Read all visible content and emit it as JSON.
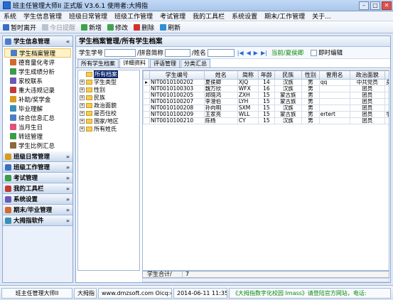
{
  "window": {
    "title": "班主任管理大师II 正式版 V3.6.1  使用者:大拇指",
    "min": "–",
    "max": "□",
    "close": "✕"
  },
  "menu": [
    "系统",
    "学生信息管理",
    "班级日常管理",
    "班级工作管理",
    "考试管理",
    "我的工具栏",
    "系统设置",
    "期末/工作管理",
    "关于..."
  ],
  "toolbar": [
    {
      "label": "暂时离开",
      "color": "#3a6fc4",
      "disabled": false
    },
    {
      "label": "今日提醒",
      "color": "#b9c2cf",
      "disabled": true
    },
    {
      "label": "新增",
      "color": "#3fa34d",
      "disabled": false
    },
    {
      "label": "修改",
      "color": "#3fa34d",
      "disabled": false
    },
    {
      "label": "删除",
      "color": "#d0332d",
      "disabled": false
    },
    {
      "label": "刷新",
      "color": "#2f8fd6",
      "disabled": false
    }
  ],
  "sidebar": {
    "group1": {
      "label": "学生信息管理",
      "chevron": "«",
      "items": [
        {
          "label": "学生档案管理",
          "color": "#4a7ec9",
          "selected": true
        },
        {
          "label": "德育量化考评",
          "color": "#d26a2e"
        },
        {
          "label": "学生成绩分析",
          "color": "#3b9c4a"
        },
        {
          "label": "家校联系",
          "color": "#6a58b8"
        },
        {
          "label": "重大违规记录",
          "color": "#c23a3a"
        },
        {
          "label": "补助/奖学金",
          "color": "#d89b1d"
        },
        {
          "label": "毕业理解",
          "color": "#3a8fb3"
        },
        {
          "label": "综合信息汇总",
          "color": "#4a7ec9"
        },
        {
          "label": "当月生日",
          "color": "#e0527a"
        },
        {
          "label": "转班管理",
          "color": "#3b9c4a"
        },
        {
          "label": "学生比例汇总",
          "color": "#8a6a3a"
        }
      ]
    },
    "groups": [
      {
        "label": "班级日常管理",
        "chevron": "»",
        "color": "#d89b1d"
      },
      {
        "label": "班级工作管理",
        "chevron": "»",
        "color": "#3a6fc4"
      },
      {
        "label": "考试管理",
        "chevron": "»",
        "color": "#3b9c4a"
      },
      {
        "label": "我的工具栏",
        "chevron": "»",
        "color": "#c23a3a"
      },
      {
        "label": "系统设置",
        "chevron": "»",
        "color": "#6a58b8"
      },
      {
        "label": "期末/毕业管理",
        "chevron": "»",
        "color": "#d26a2e"
      },
      {
        "label": "大拇指软件",
        "chevron": "»",
        "color": "#3a8fb3"
      }
    ]
  },
  "main": {
    "title": "学生档案管理/所有学生档案",
    "search": {
      "label_id": "学生学号",
      "label_py": "/拼音简称",
      "label_name": "/姓名",
      "nav": [
        "|◀",
        "◀",
        "▶",
        "▶|"
      ],
      "link": "当前/夏侯卿",
      "instant_edit": "即时编辑"
    },
    "tabs": [
      "所有学生档案",
      "详细资料",
      "评语管理",
      "分类汇总"
    ],
    "tree": [
      {
        "label": "所有档案",
        "pm": "",
        "selected": true
      },
      {
        "label": "学生类型",
        "pm": "+"
      },
      {
        "label": "性别",
        "pm": "+"
      },
      {
        "label": "民族",
        "pm": "+"
      },
      {
        "label": "政治面貌",
        "pm": "+"
      },
      {
        "label": "是否住校",
        "pm": "+"
      },
      {
        "label": "国家/地区",
        "pm": "+"
      },
      {
        "label": "所有姓氏",
        "pm": "+"
      }
    ],
    "table": {
      "columns": [
        "学生编号",
        "姓名",
        "简称",
        "年龄",
        "民族",
        "性别",
        "曾用名",
        "政治面貌",
        "证件类型",
        "证件号"
      ],
      "rows": [
        [
          "NIT0010100202",
          "夏侯卿",
          "XJQ",
          "14",
          "汉族",
          "男",
          "qq",
          "中共党员",
          "身份证",
          "362196"
        ],
        [
          "NIT0010100303",
          "魏万欣",
          "WFX",
          "16",
          "汉族",
          "男",
          "",
          "团员",
          "",
          ""
        ],
        [
          "NIT0010100205",
          "郑晓鸿",
          "ZXH",
          "15",
          "蒙古族",
          "男",
          "",
          "团员",
          "",
          ""
        ],
        [
          "NIT0010100207",
          "李澄伯",
          "LYH",
          "15",
          "蒙古族",
          "男",
          "",
          "团员",
          "",
          ""
        ],
        [
          "NIT0010100208",
          "孙向明",
          "SXM",
          "15",
          "汉族",
          "男",
          "",
          "团员",
          "",
          ""
        ],
        [
          "NIT0010100209",
          "王家亮",
          "WLL",
          "15",
          "蒙古族",
          "男",
          "ertert",
          "团员",
          "学生证",
          ""
        ],
        [
          "NIT0010100210",
          "陈杨",
          "CY",
          "15",
          "汉族",
          "男",
          "",
          "团员",
          "",
          ""
        ]
      ],
      "footer_label": "学生合计/",
      "footer_value": "7"
    }
  },
  "status": {
    "app": "班主任管理大师II",
    "user": "大拇指",
    "site": "www.dmzsoft.com Oicq:4619857",
    "time": "2014-06-11  11:35:26",
    "promo": "《大拇指数字化校园 Imass》请登陆官方网站，电话:"
  }
}
